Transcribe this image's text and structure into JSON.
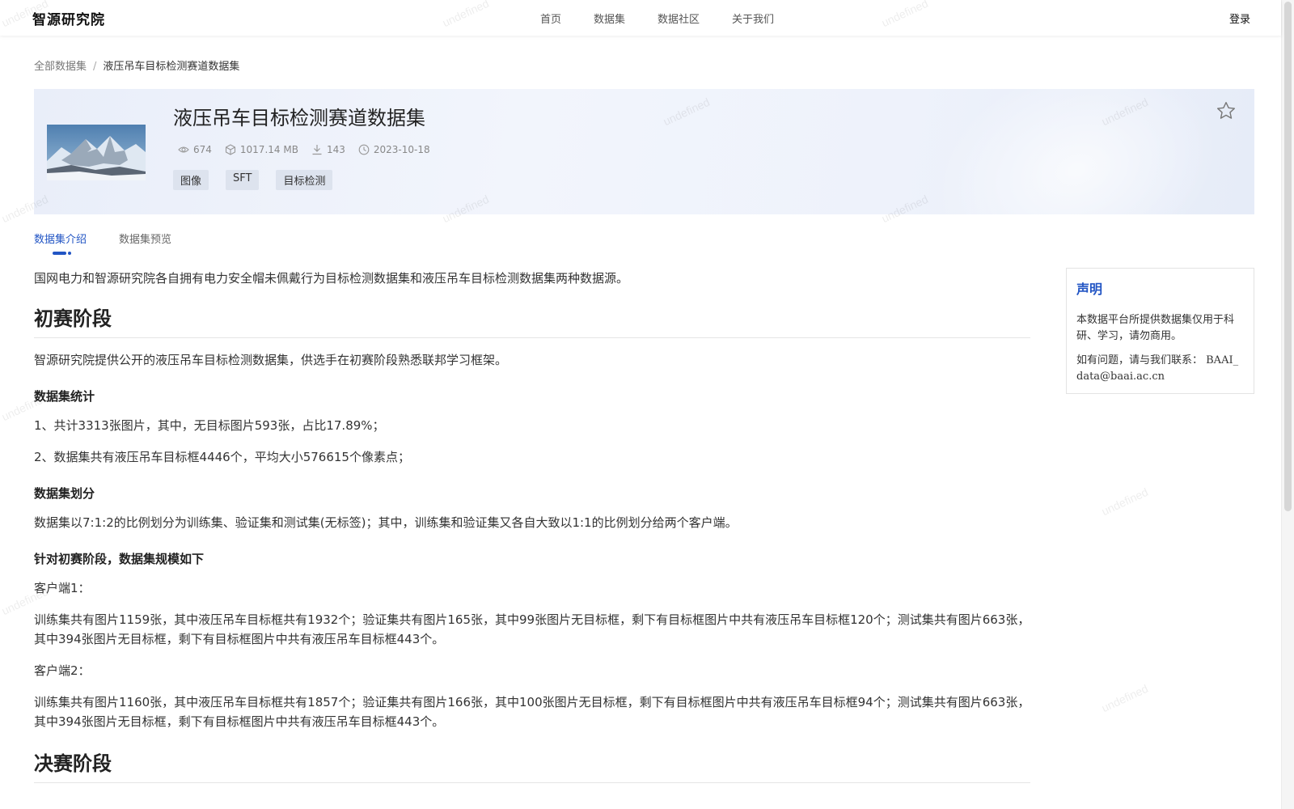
{
  "nav": {
    "logo": "智源研究院",
    "links": [
      "首页",
      "数据集",
      "数据社区",
      "关于我们"
    ],
    "login": "登录"
  },
  "watermark_text": "undefined",
  "breadcrumb": {
    "root": "全部数据集",
    "separator": "/",
    "current": "液压吊车目标检测赛道数据集"
  },
  "dataset": {
    "title": "液压吊车目标检测赛道数据集",
    "views": "674",
    "size": "1017.14 MB",
    "downloads": "143",
    "date": "2023-10-18",
    "tags": [
      "图像",
      "SFT",
      "目标检测"
    ]
  },
  "tabs": [
    "数据集介绍",
    "数据集预览"
  ],
  "article": {
    "intro": "国网电力和智源研究院各自拥有电力安全帽未佩戴行为目标检测数据集和液压吊车目标检测数据集两种数据源。",
    "section1_title": "初赛阶段",
    "section1_desc": "智源研究院提供公开的液压吊车目标检测数据集，供选手在初赛阶段熟悉联邦学习框架。",
    "stats_title": "数据集统计",
    "stats_1": "1、共计3313张图片，其中，无目标图片593张，占比17.89%；",
    "stats_2": "2、数据集共有液压吊车目标框4446个，平均大小576615个像素点；",
    "split_title": "数据集划分",
    "split_desc": "数据集以7:1:2的比例划分为训练集、验证集和测试集(无标签)；其中，训练集和验证集又各自大致以1:1的比例划分给两个客户端。",
    "scale_title": "针对初赛阶段，数据集规模如下",
    "client1_label": "客户端1：",
    "client1_desc": "训练集共有图片1159张，其中液压吊车目标框共有1932个；验证集共有图片165张，其中99张图片无目标框，剩下有目标框图片中共有液压吊车目标框120个；测试集共有图片663张，其中394张图片无目标框，剩下有目标框图片中共有液压吊车目标框443个。",
    "client2_label": "客户端2：",
    "client2_desc": "训练集共有图片1160张，其中液压吊车目标框共有1857个；验证集共有图片166张，其中100张图片无目标框，剩下有目标框图片中共有液压吊车目标框94个；测试集共有图片663张，其中394张图片无目标框，剩下有目标框图片中共有液压吊车目标框443个。",
    "section2_title": "决赛阶段"
  },
  "notice": {
    "title": "声明",
    "text1": "本数据平台所提供数据集仅用于科研、学习，请勿商用。",
    "text2": "如有问题，请与我们联系： BAAI_data@baai.ac.cn"
  },
  "colors": {
    "accent": "#2255c4",
    "header_bg": "#eef2fb",
    "tag_bg": "#dde3ee"
  }
}
